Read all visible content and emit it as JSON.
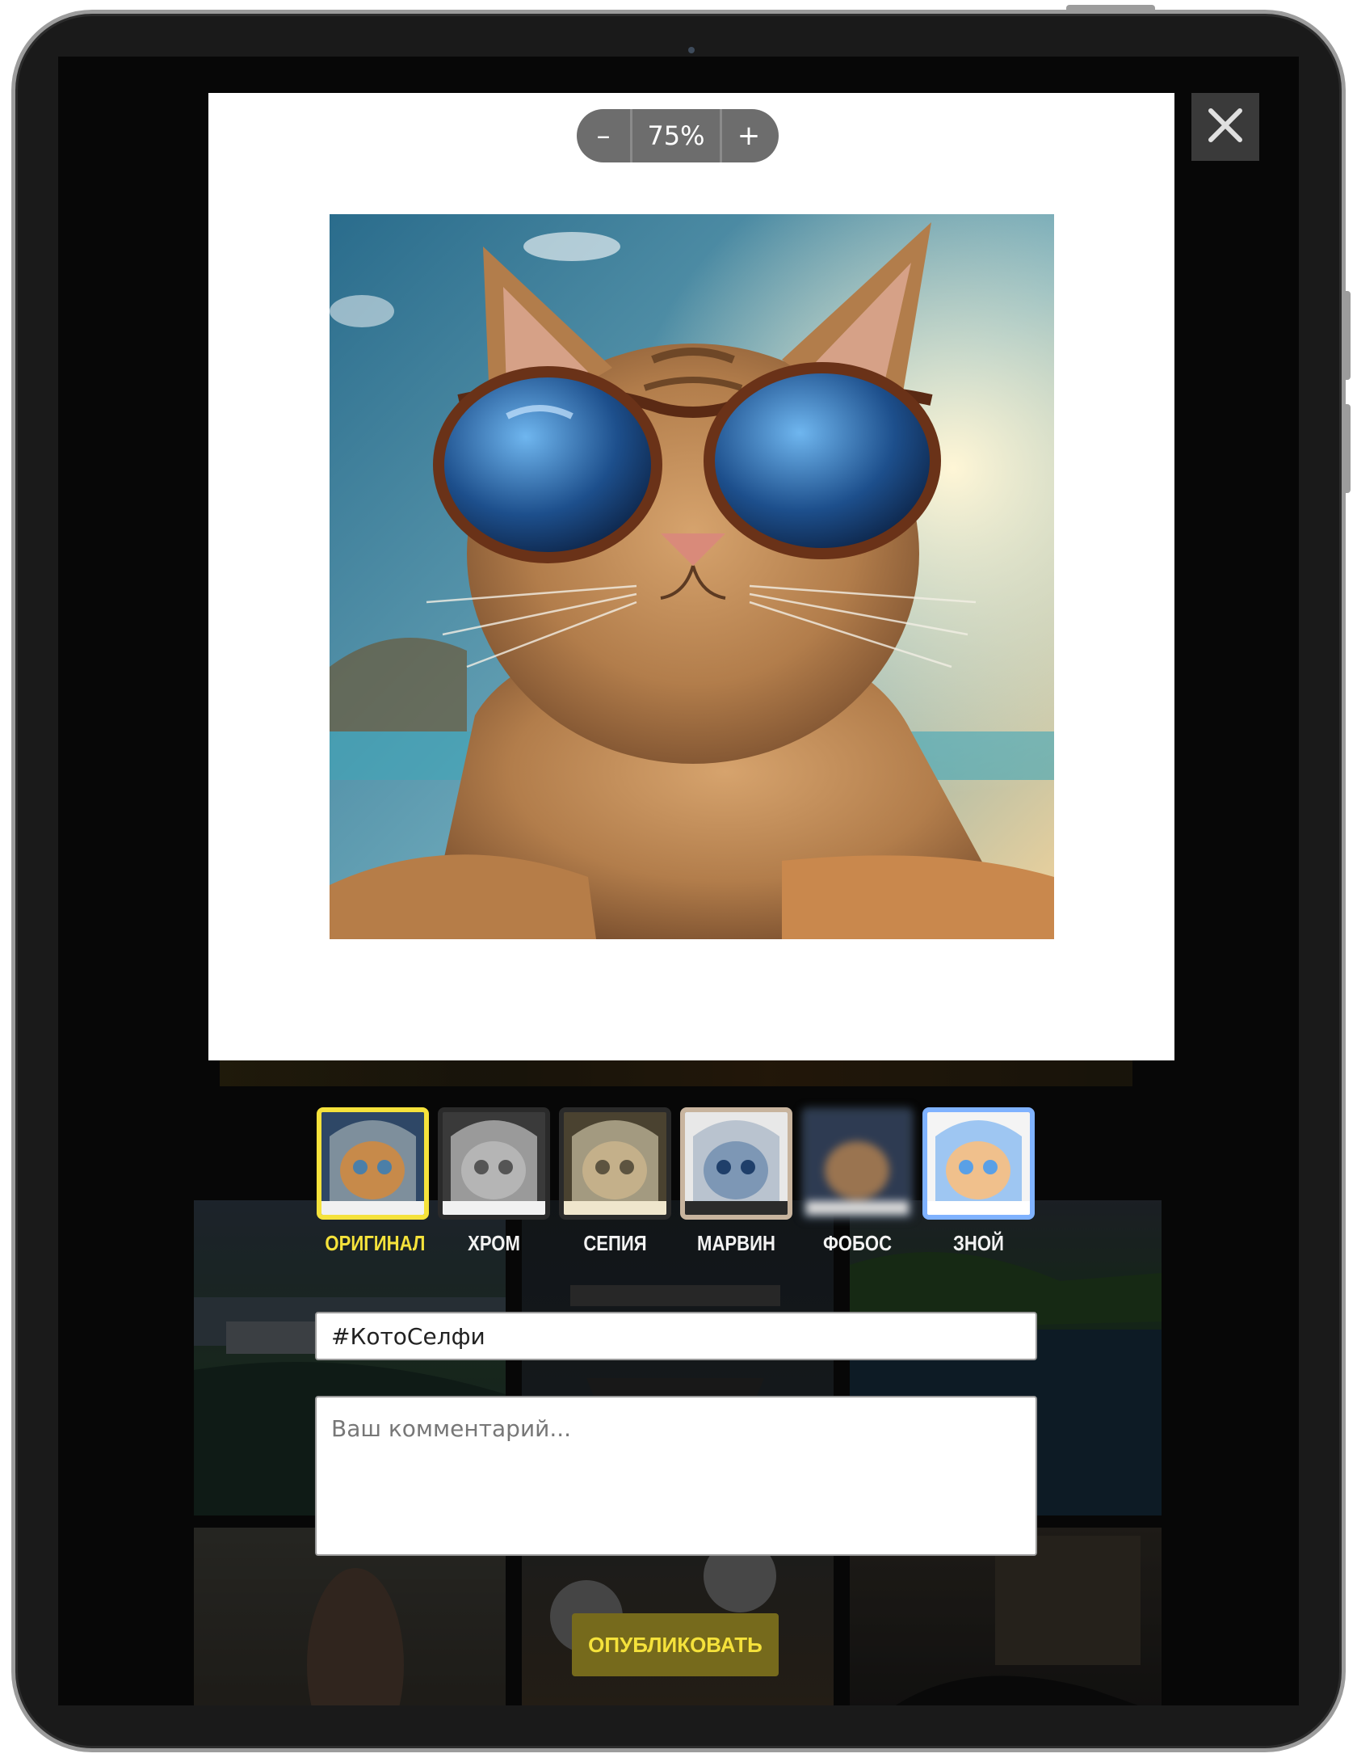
{
  "zoom": {
    "minus_label": "–",
    "value": "75%",
    "plus_label": "+"
  },
  "close_icon": "close-icon",
  "photo": {
    "subject": "cat-in-sunglasses-selfie"
  },
  "filters": [
    {
      "label": "ОРИГИНАЛ",
      "selected": true
    },
    {
      "label": "ХРОМ",
      "selected": false
    },
    {
      "label": "СЕПИЯ",
      "selected": false
    },
    {
      "label": "МАРВИН",
      "selected": false
    },
    {
      "label": "ФОБОС",
      "selected": false
    },
    {
      "label": "ЗНОЙ",
      "selected": false
    }
  ],
  "hashtag": {
    "value": "#КотоСелфи"
  },
  "comment": {
    "placeholder": "Ваш комментарий..."
  },
  "publish": {
    "label": "ОПУБЛИКОВАТЬ"
  },
  "colors": {
    "accent": "#f5e23b",
    "background": "#0b0b0b",
    "frame": "#1a1a1a"
  }
}
